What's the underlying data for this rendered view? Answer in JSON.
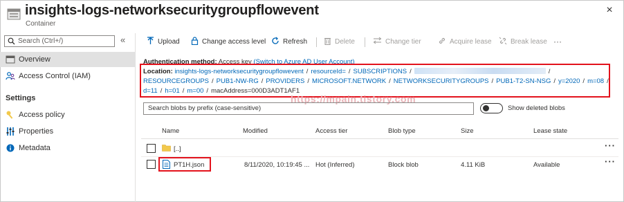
{
  "header": {
    "title": "insights-logs-networksecuritygroupflowevent",
    "subtitle": "Container",
    "close_glyph": "×"
  },
  "sidebar": {
    "search_placeholder": "Search (Ctrl+/)",
    "collapse_glyph": "«",
    "items": [
      {
        "label": "Overview",
        "icon": "container-icon",
        "active": true
      },
      {
        "label": "Access Control (IAM)",
        "icon": "people-icon",
        "active": false
      }
    ],
    "section_title": "Settings",
    "settings_items": [
      {
        "label": "Access policy",
        "icon": "key-icon"
      },
      {
        "label": "Properties",
        "icon": "sliders-icon"
      },
      {
        "label": "Metadata",
        "icon": "info-icon"
      }
    ]
  },
  "toolbar": {
    "upload": "Upload",
    "change_access_level": "Change access level",
    "refresh": "Refresh",
    "delete": "Delete",
    "change_tier": "Change tier",
    "acquire_lease": "Acquire lease",
    "break_lease": "Break lease",
    "more": "···"
  },
  "info": {
    "auth_label": "Authentication method:",
    "auth_value": "Access key",
    "auth_switch": "(Switch to Azure AD User Account)",
    "location_label": "Location:",
    "separator": "/",
    "location_line1": [
      "insights-logs-networksecuritygroupflowevent",
      "resourceId=",
      "SUBSCRIPTIONS"
    ],
    "location_line2": [
      "RESOURCEGROUPS",
      "PUB1-NW-RG",
      "PROVIDERS",
      "MICROSOFT.NETWORK",
      "NETWORKSECURITYGROUPS",
      "PUB1-T2-SN-NSG",
      "y=2020",
      "m=08"
    ],
    "location_line3": [
      "d=11",
      "h=01",
      "m=00"
    ],
    "location_tail": "macAddress=000D3ADT1AF1"
  },
  "watermark": "https://mpain.tistory.com",
  "blob_search": {
    "placeholder": "Search blobs by prefix (case-sensitive)",
    "show_deleted_label": "Show deleted blobs",
    "show_deleted_on": false
  },
  "table": {
    "columns": [
      "Name",
      "Modified",
      "Access tier",
      "Blob type",
      "Size",
      "Lease state"
    ],
    "rows": [
      {
        "name": "[..]",
        "icon": "folder-icon",
        "modified": "",
        "access_tier": "",
        "blob_type": "",
        "size": "",
        "lease_state": "",
        "more": "···"
      },
      {
        "name": "PT1H.json",
        "icon": "file-icon",
        "modified": "8/11/2020, 10:19:45 ...",
        "access_tier": "Hot (Inferred)",
        "blob_type": "Block blob",
        "size": "4.11 KiB",
        "lease_state": "Available",
        "more": "···"
      }
    ]
  },
  "colors": {
    "accent": "#0067b8",
    "highlight_red": "#e3121c",
    "folder": "#f2c94c"
  }
}
